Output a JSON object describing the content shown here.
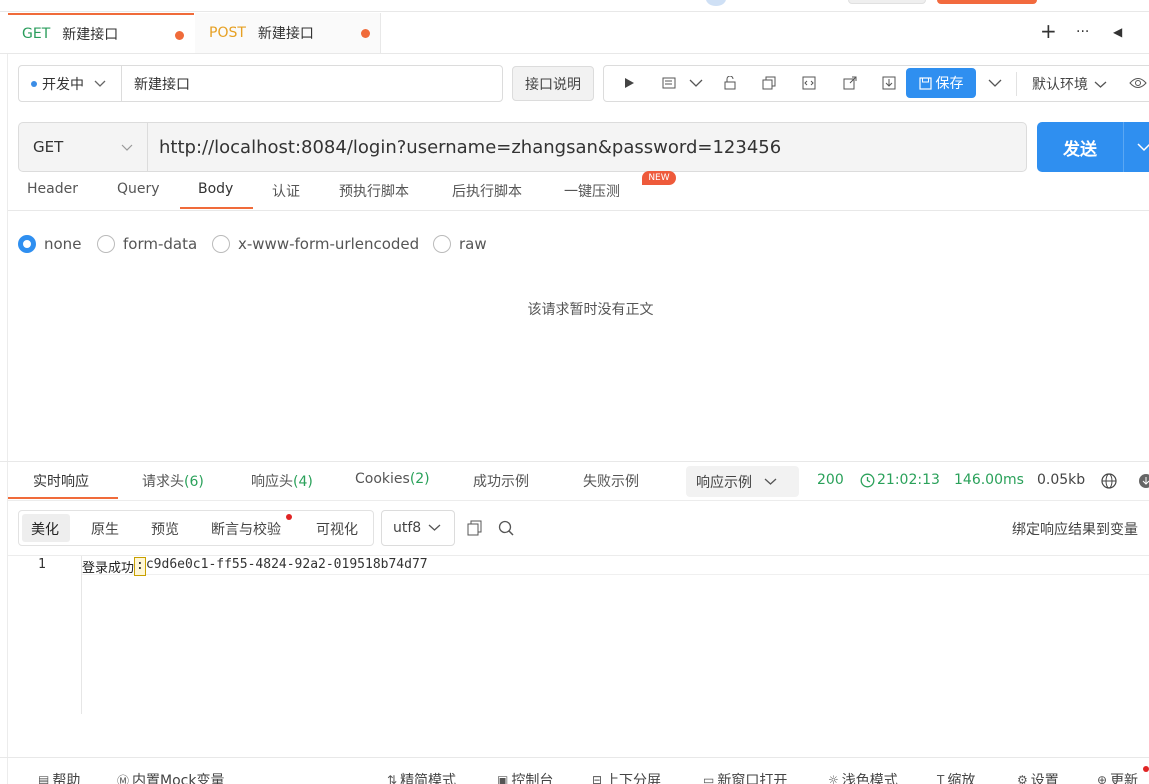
{
  "tabs": [
    {
      "method": "GET",
      "name": "新建接口"
    },
    {
      "method": "POST",
      "name": "新建接口"
    }
  ],
  "tab_actions": {
    "add": "+",
    "more": "···",
    "collapse": "◀"
  },
  "request": {
    "status": "开发中",
    "name": "新建接口",
    "doc_button": "接口说明",
    "save_button": "保存",
    "environment": "默认环境",
    "method": "GET",
    "url": "http://localhost:8084/login?username=zhangsan&password=123456",
    "send_button": "发送"
  },
  "request_tabs": [
    "Header",
    "Query",
    "Body",
    "认证",
    "预执行脚本",
    "后执行脚本",
    "一键压测"
  ],
  "new_badge": "NEW",
  "body_types": [
    "none",
    "form-data",
    "x-www-form-urlencoded",
    "raw"
  ],
  "body_empty_note": "该请求暂时没有正文",
  "response": {
    "tabs": {
      "realtime": "实时响应",
      "req_headers": "请求头",
      "req_headers_count": "(6)",
      "resp_headers": "响应头",
      "resp_headers_count": "(4)",
      "cookies": "Cookies",
      "cookies_count": "(2)",
      "success_example": "成功示例",
      "fail_example": "失败示例"
    },
    "example_select": "响应示例",
    "status_code": "200",
    "time": "21:02:13",
    "duration": "146.00ms",
    "size": "0.05kb",
    "view_tabs": [
      "美化",
      "原生",
      "预览",
      "断言与校验",
      "可视化"
    ],
    "encoding": "utf8",
    "bind_label": "绑定响应结果到变量",
    "lines": [
      {
        "num": "1",
        "prefix": "登录成功",
        "sep": ":",
        "value": "c9d6e0c1-ff55-4824-92a2-019518b74d77"
      }
    ]
  },
  "footer": [
    "帮助",
    "内置Mock变量",
    "精简模式",
    "控制台",
    "上下分屏",
    "新窗口打开",
    "浅色模式",
    "缩放",
    "设置",
    "更新"
  ],
  "colors": {
    "accent": "#2f8ff0",
    "orange": "#f06b3a",
    "get": "#2a9d5c",
    "post": "#e6a023",
    "success": "#2aa15a"
  }
}
